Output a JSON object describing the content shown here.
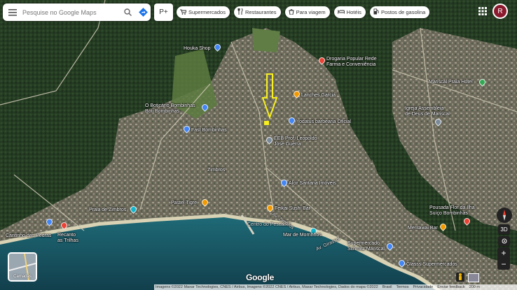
{
  "search": {
    "placeholder": "Pesquise no Google Maps"
  },
  "layer_quick_label": "P+",
  "chips": [
    {
      "label": "Supermercados",
      "icon": "cart-icon"
    },
    {
      "label": "Restaurantes",
      "icon": "fork-knife-icon"
    },
    {
      "label": "Para viagem",
      "icon": "takeout-bag-icon"
    },
    {
      "label": "Hotéis",
      "icon": "bed-icon"
    },
    {
      "label": "Postos de gasolina",
      "icon": "gas-pump-icon"
    }
  ],
  "account": {
    "initial": "R",
    "color": "#8b1a2e"
  },
  "places": [
    {
      "name": "Houka Shop",
      "pin": "blue"
    },
    {
      "name": "Drogaria Popular Rede\nFarma e Conveniência",
      "pin": "red"
    },
    {
      "name": "Lanches Garcia",
      "pin": "orange"
    },
    {
      "name": "O Boticário Bombinhas\nBoti Bombinhas",
      "pin": "blue"
    },
    {
      "name": "Fast Bombinhas",
      "pin": "blue"
    },
    {
      "name": "Yodatus barbearia Oficial",
      "pin": "blue"
    },
    {
      "name": "EEB Prof. Leopoldo\nJosé Guerra",
      "pin": "gray"
    },
    {
      "name": "Zimbros",
      "pin": "none"
    },
    {
      "name": "Alcir Santana Imóveis",
      "pin": "blue"
    },
    {
      "name": "Praia de Zimbros",
      "pin": "teal"
    },
    {
      "name": "Pastel Tigre",
      "pin": "orange"
    },
    {
      "name": "Feikai Sushi Bar",
      "pin": "orange"
    },
    {
      "name": "Centro do Pescador",
      "pin": "none"
    },
    {
      "name": "Cantinho das Pedras",
      "pin": "blue"
    },
    {
      "name": "Recanto\nas Trilhas",
      "pin": "red"
    },
    {
      "name": "Mariscal Praia Hotel",
      "pin": "green"
    },
    {
      "name": "Igreja Assembleia\nde Deus de Mariscal",
      "pin": "gray"
    },
    {
      "name": "Pousada Flor da Ilha\nSuíço Bombinhas",
      "pin": "red"
    },
    {
      "name": "Mentawai Bar",
      "pin": "orange"
    },
    {
      "name": "Supermercado\nSchmitz Mariscal",
      "pin": "blue"
    },
    {
      "name": "Glasss Supermercados",
      "pin": "blue"
    },
    {
      "name": "Mar de Morrinhos",
      "pin": "teal"
    },
    {
      "name": "Av. Zimbros",
      "pin": "none"
    },
    {
      "name": "Av. Girassol",
      "pin": "none"
    }
  ],
  "layers_button": "Camadas",
  "controls": {
    "three_d": "3D",
    "zoom_in": "+",
    "zoom_out": "−"
  },
  "brand": "Google",
  "footer": {
    "imagery": "Imagens ©2022 Maxar Technologies, CNES / Airbus, Imagens ©2022 CNES / Airbus, Maxar Technologies, Dados do mapa ©2022",
    "links": [
      "Brasil",
      "Termos",
      "Privacidade",
      "Enviar feedback"
    ],
    "scale": "200 m"
  },
  "colors": {
    "pin_blue": "#4285f4",
    "pin_red": "#ea4335",
    "pin_orange": "#f29900",
    "pin_teal": "#12b5cb",
    "pin_green": "#34a853",
    "pin_gray": "#7a8a99",
    "pin_yellow_outline": "#f7ef1e"
  }
}
